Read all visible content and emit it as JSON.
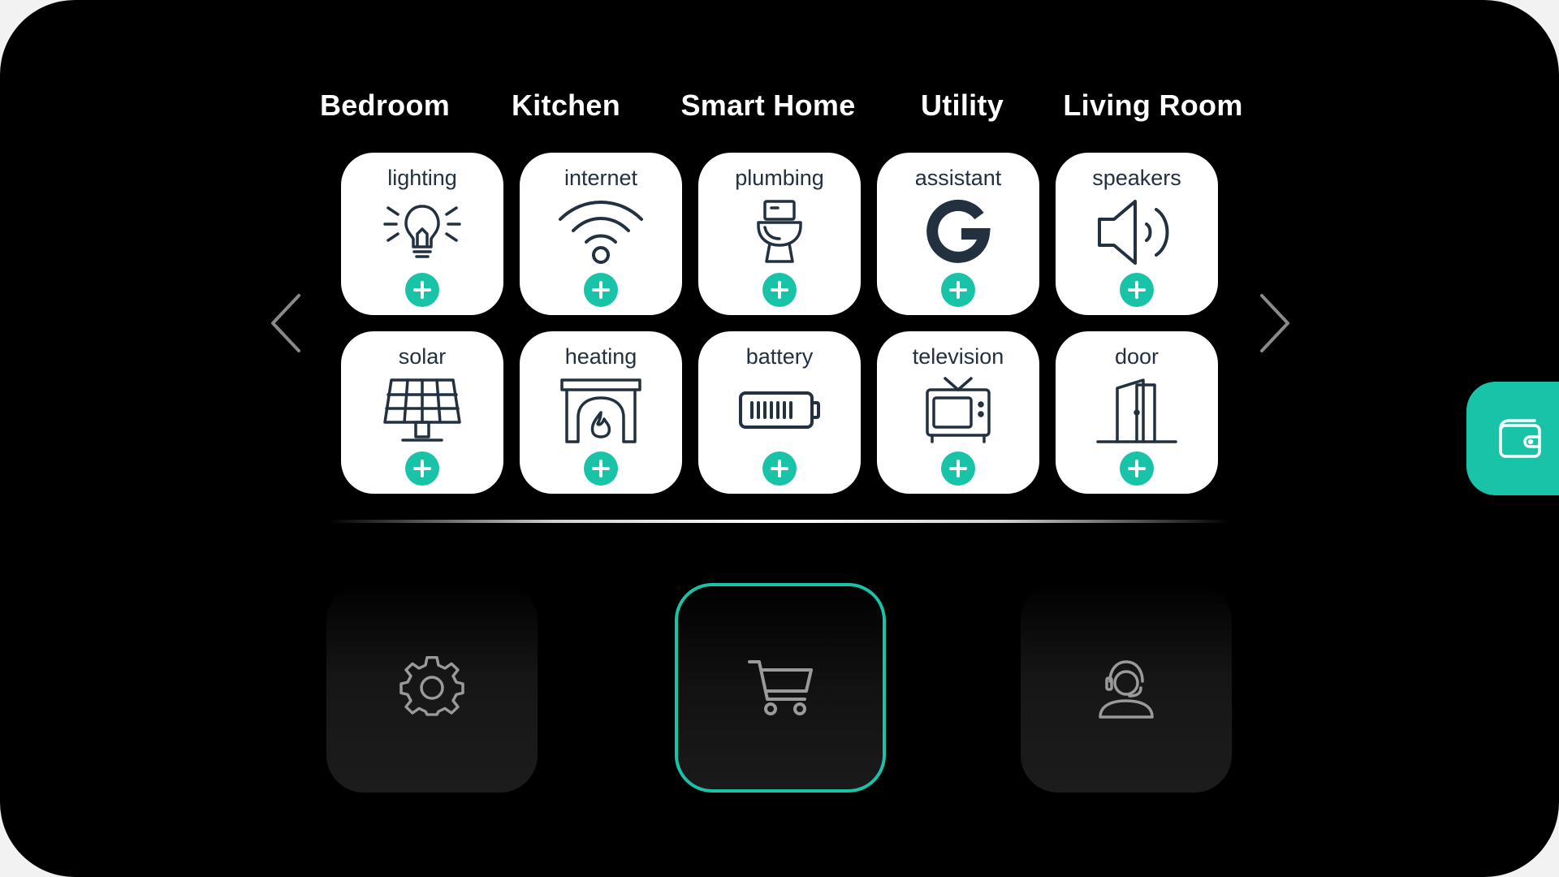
{
  "categories": [
    "Bedroom",
    "Kitchen",
    "Smart Home",
    "Utility",
    "Living Room"
  ],
  "tiles": [
    {
      "label": "lighting",
      "icon": "lightbulb-icon"
    },
    {
      "label": "internet",
      "icon": "wifi-icon"
    },
    {
      "label": "plumbing",
      "icon": "toilet-icon"
    },
    {
      "label": "assistant",
      "icon": "google-icon"
    },
    {
      "label": "speakers",
      "icon": "speaker-icon"
    },
    {
      "label": "solar",
      "icon": "solar-panel-icon"
    },
    {
      "label": "heating",
      "icon": "fireplace-icon"
    },
    {
      "label": "battery",
      "icon": "battery-icon"
    },
    {
      "label": "television",
      "icon": "television-icon"
    },
    {
      "label": "door",
      "icon": "door-icon"
    }
  ],
  "navigation": {
    "prev_icon": "chevron-left-icon",
    "next_icon": "chevron-right-icon"
  },
  "actions": [
    {
      "name": "settings",
      "icon": "gear-icon",
      "active": false
    },
    {
      "name": "cart",
      "icon": "cart-icon",
      "active": true
    },
    {
      "name": "support",
      "icon": "support-agent-icon",
      "active": false
    }
  ],
  "side_tab": {
    "icon": "wallet-icon"
  },
  "colors": {
    "background": "#000000",
    "accent": "#19c3a7",
    "tile": "#ffffff",
    "icon_ink": "#22303f",
    "action_icon": "#9a9a9a"
  }
}
